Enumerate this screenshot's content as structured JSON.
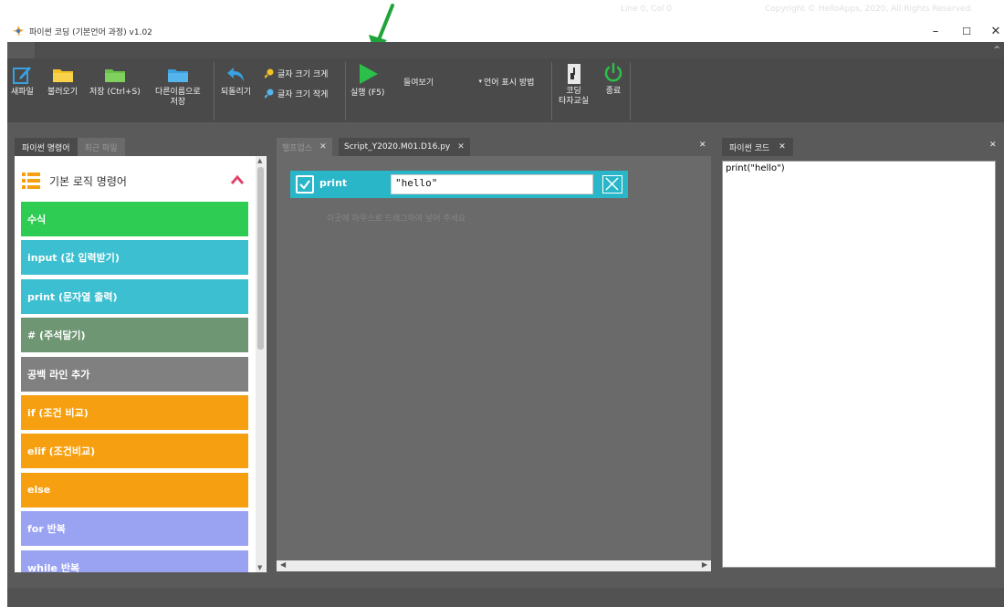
{
  "window": {
    "title": "파이썬 코딩 (기본언어 과정) v1.02",
    "controls": {
      "minimize": "–",
      "maximize": "☐",
      "close": "✕"
    }
  },
  "ribbon": {
    "new_file": "새파일",
    "open": "불러오기",
    "save": "저장 (Ctrl+S)",
    "save_as_line1": "다른이름으로",
    "save_as_line2": "저장",
    "undo": "되돌리기",
    "font_bigger": "글자 크기 크게",
    "font_smaller": "글자 크기 작게",
    "run": "실행 (F5)",
    "view_select": "들여보기",
    "lang_display": "언어 표시 방법",
    "typing_line1": "코딩",
    "typing_line2": "타자교실",
    "exit": "종료",
    "collapse": "^"
  },
  "left_panel": {
    "tabs": [
      "파이썬 명령어",
      "최근 파일"
    ],
    "category_title": "기본 로직 명령어",
    "commands": [
      {
        "label": "수식",
        "color": "#2ecc52"
      },
      {
        "label": "input (값 입력받기)",
        "color": "#3cbfd0"
      },
      {
        "label": "print (문자열 출력)",
        "color": "#3cbfd0"
      },
      {
        "label": "# (주석달기)",
        "color": "#6e9673"
      },
      {
        "label": "공백 라인 추가",
        "color": "#808080"
      },
      {
        "label": "if (조건 비교)",
        "color": "#f6a011"
      },
      {
        "label": "elif (조건비교)",
        "color": "#f6a011"
      },
      {
        "label": "else",
        "color": "#f6a011"
      },
      {
        "label": "for 반복",
        "color": "#9aa2f2"
      },
      {
        "label": "while 반복",
        "color": "#9aa2f2"
      }
    ]
  },
  "center_panel": {
    "tabs": [
      {
        "label": "헬프업스",
        "close": "✕"
      },
      {
        "label": "Script_Y2020.M01.D16.py",
        "close": "✕"
      }
    ],
    "panel_close": "✕",
    "block": {
      "label": "print",
      "value": "\"hello\""
    },
    "drop_hint": "이곳에 마우스로 드래그하여 넣어 주세요"
  },
  "right_panel": {
    "tab": "파이썬 코드",
    "close": "✕",
    "panel_close": "✕",
    "code": "print(\"hello\")"
  },
  "status": {
    "position": "Line 0, Col 0",
    "copyright": "Copyright © HelloApps, 2020, All Rights Reserved."
  },
  "colors": {
    "ribbon_bg": "#4a4a4a",
    "workspace_bg": "#5a5a5a",
    "block_cyan": "#29b6c9",
    "run_green": "#2bc04a",
    "folder_yellow": "#f5c226",
    "folder_green": "#69c04a",
    "folder_blue": "#3aa0e0",
    "annotation_arrow": "#1fa43a"
  }
}
